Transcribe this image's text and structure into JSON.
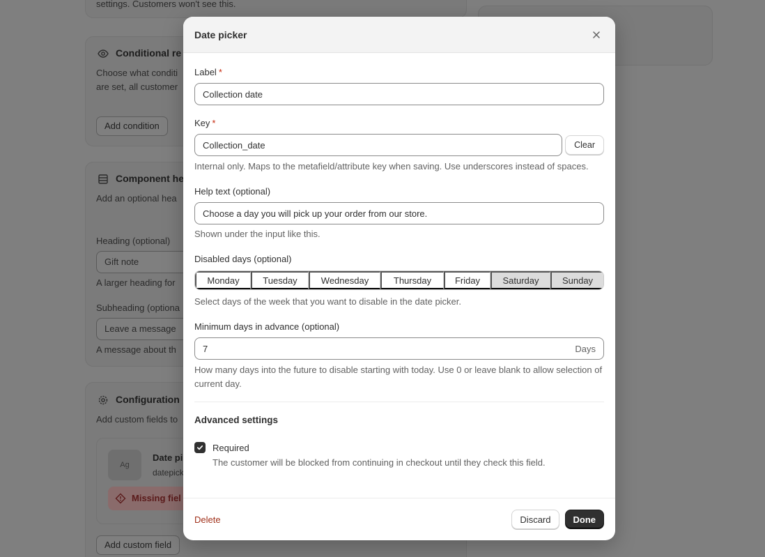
{
  "background": {
    "top_text": "settings. Customers won't see this.",
    "conditional": {
      "title": "Conditional re",
      "line1": "Choose what conditi",
      "line2": "are set, all customer",
      "button": "Add condition"
    },
    "component_header": {
      "title": "Component he",
      "desc": "Add an optional hea",
      "heading_label": "Heading (optional)",
      "heading_value": "Gift note",
      "heading_help": "A larger heading for",
      "subheading_label": "Subheading (optiona",
      "subheading_value": "Leave a message",
      "subheading_help": "A message about th"
    },
    "configuration": {
      "title": "Configuration",
      "desc": "Add custom fields to",
      "item_title": "Date pi",
      "item_sub": "datepick",
      "thumb_label": "Ag",
      "error": "Missing fiel",
      "add_button": "Add custom field"
    }
  },
  "modal": {
    "title": "Date picker",
    "label_field": {
      "label": "Label",
      "required_mark": "*",
      "value": "Collection date"
    },
    "key_field": {
      "label": "Key",
      "required_mark": "*",
      "value": "Collection_date",
      "clear": "Clear",
      "help": "Internal only. Maps to the metafield/attribute key when saving. Use underscores instead of spaces."
    },
    "help_text_field": {
      "label": "Help text (optional)",
      "value": "Choose a day you will pick up your order from our store.",
      "help": "Shown under the input like this."
    },
    "disabled_days": {
      "label": "Disabled days (optional)",
      "days": [
        "Monday",
        "Tuesday",
        "Wednesday",
        "Thursday",
        "Friday",
        "Saturday",
        "Sunday"
      ],
      "selected": [
        "Saturday",
        "Sunday"
      ],
      "help": "Select days of the week that you want to disable in the date picker."
    },
    "min_days": {
      "label": "Minimum days in advance (optional)",
      "value": "7",
      "suffix": "Days",
      "help": "How many days into the future to disable starting with today. Use 0 or leave blank to allow selection of current day."
    },
    "advanced": {
      "title": "Advanced settings",
      "required_label": "Required",
      "required_checked": true,
      "required_help": "The customer will be blocked from continuing in checkout until they check this field."
    },
    "footer": {
      "delete": "Delete",
      "discard": "Discard",
      "done": "Done"
    }
  },
  "colors": {
    "overlay": "#7f7f7f",
    "primary_button": "#303030",
    "danger": "#a0301a",
    "selected_day": "#dcdcdc"
  }
}
